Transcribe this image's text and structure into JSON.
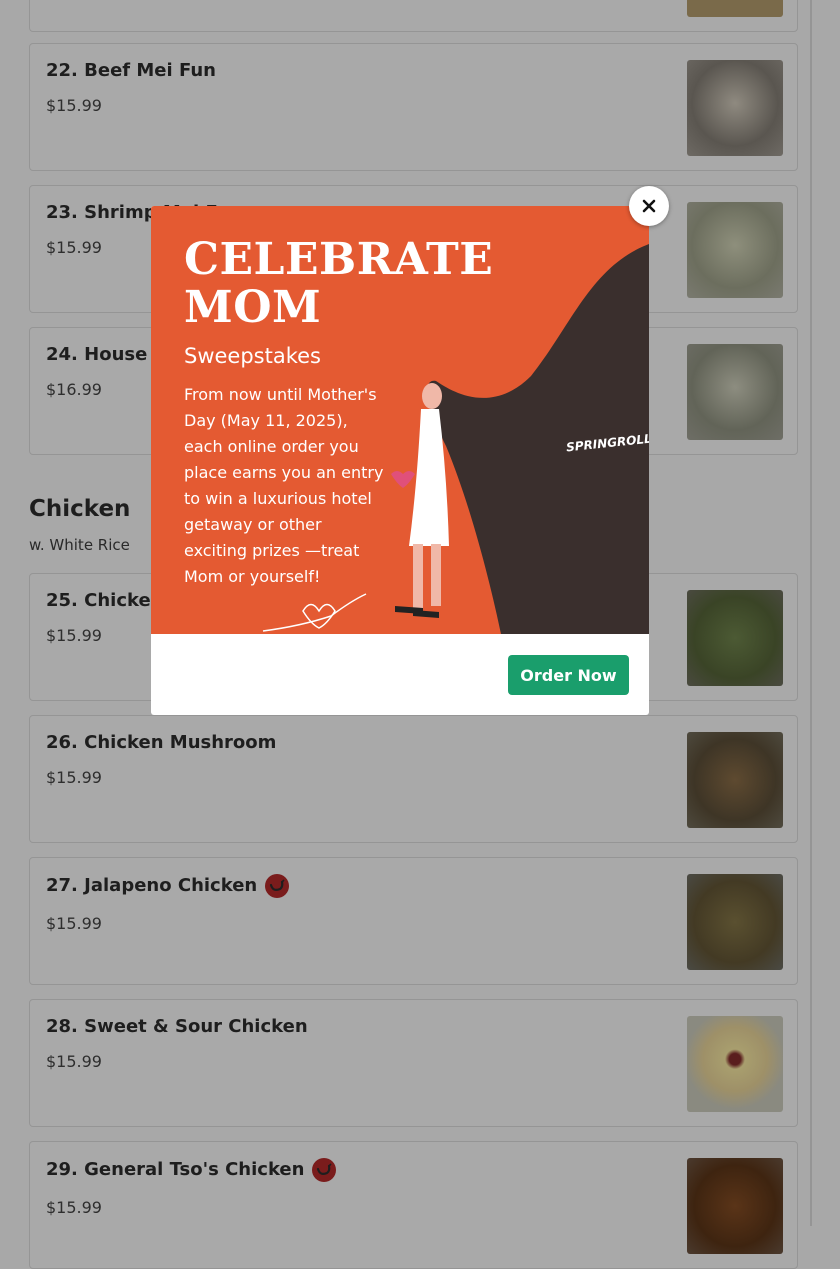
{
  "menu": {
    "items": [
      {
        "name": "22. Beef Mei Fun",
        "price": "$15.99"
      },
      {
        "name": "23. Shrimp Mei Fun",
        "price": "$15.99"
      },
      {
        "name": "24. House Special Mei Fun",
        "price": "$16.99"
      },
      {
        "name": "25. Chicken w. Broccoli",
        "price": "$15.99"
      },
      {
        "name": "26. Chicken Mushroom",
        "price": "$15.99"
      },
      {
        "name": "27. Jalapeno Chicken",
        "price": "$15.99",
        "spicy": true
      },
      {
        "name": "28. Sweet & Sour Chicken",
        "price": "$15.99"
      },
      {
        "name": "29. General Tso's Chicken",
        "price": "$15.99",
        "spicy": true
      }
    ],
    "section": {
      "title": "Chicken",
      "subtitle": "w. White Rice"
    }
  },
  "modal": {
    "headline_line1": "CELEBRATE",
    "headline_line2": "MOM",
    "subheadline": "Sweepstakes",
    "description": "From now until Mother's Day (May 11, 2025), each online order you place earns you an entry to win a luxurious hotel getaway or other exciting prizes —treat Mom or yourself!",
    "brand": "SPRINGROLL",
    "button_label": "Order Now",
    "close_icon": "close-icon"
  },
  "colors": {
    "promo_bg": "#e45a32",
    "button": "#1a9e6c",
    "spicy_badge": "#7a1c1c"
  }
}
